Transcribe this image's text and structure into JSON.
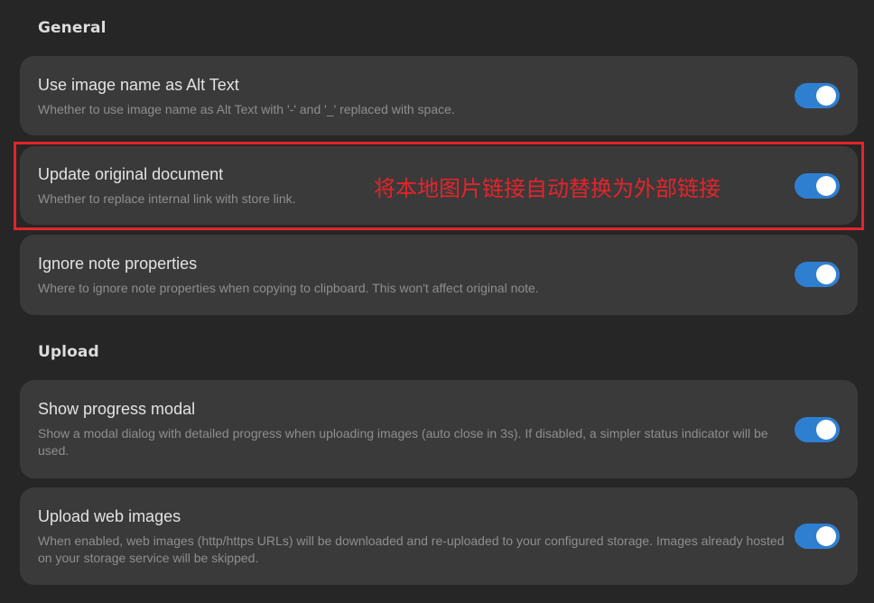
{
  "colors": {
    "background": "#262626",
    "card": "#3a3a3a",
    "toggle_on": "#2f7fd1",
    "highlight": "#e3242b"
  },
  "sections": {
    "general": {
      "heading": "General"
    },
    "upload": {
      "heading": "Upload"
    }
  },
  "settings": {
    "alt_text": {
      "title": "Use image name as Alt Text",
      "desc": "Whether to use image name as Alt Text with '-' and '_' replaced with space.",
      "enabled": true
    },
    "update_doc": {
      "title": "Update original document",
      "desc": "Whether to replace internal link with store link.",
      "enabled": true
    },
    "ignore_props": {
      "title": "Ignore note properties",
      "desc": "Where to ignore note properties when copying to clipboard. This won't affect original note.",
      "enabled": true
    },
    "progress_modal": {
      "title": "Show progress modal",
      "desc": "Show a modal dialog with detailed progress when uploading images (auto close in 3s). If disabled, a simpler status indicator will be used.",
      "enabled": true
    },
    "web_images": {
      "title": "Upload web images",
      "desc": "When enabled, web images (http/https URLs) will be downloaded and re-uploaded to your configured storage. Images already hosted on your storage service will be skipped.",
      "enabled": true
    }
  },
  "annotation": {
    "text": "将本地图片链接自动替换为外部链接"
  }
}
